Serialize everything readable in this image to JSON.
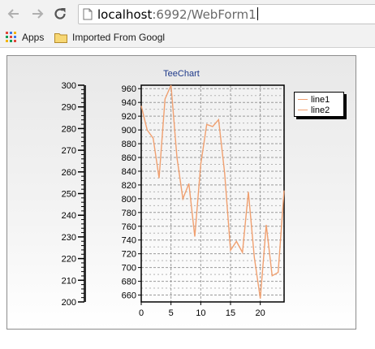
{
  "browser": {
    "url_host": "localhost",
    "url_rest": ":6992/WebForm1",
    "bookmarks": [
      {
        "label": "Apps",
        "icon": "apps-grid-icon"
      },
      {
        "label": "Imported From Googl",
        "icon": "folder-icon"
      }
    ]
  },
  "chart_data": {
    "type": "line",
    "title": "TeeChart",
    "left_axis": {
      "ticks": [
        "300",
        "290",
        "280",
        "270",
        "260",
        "250",
        "240",
        "230",
        "220",
        "210",
        "200"
      ],
      "ylim": [
        200,
        300
      ]
    },
    "ylim": [
      650,
      965
    ],
    "yticks": [
      "960",
      "940",
      "920",
      "900",
      "880",
      "860",
      "840",
      "820",
      "800",
      "780",
      "760",
      "740",
      "720",
      "700",
      "680",
      "660"
    ],
    "xlim": [
      0,
      24
    ],
    "xticks": [
      "0",
      "5",
      "10",
      "15",
      "20"
    ],
    "x": [
      0,
      1,
      2,
      3,
      4,
      5,
      6,
      7,
      8,
      9,
      10,
      11,
      12,
      13,
      14,
      15,
      16,
      17,
      18,
      19,
      20,
      21,
      22,
      23,
      24
    ],
    "series": [
      {
        "name": "line1",
        "color": "#f0a070",
        "values": [
          935,
          900,
          888,
          830,
          945,
          965,
          860,
          800,
          822,
          745,
          850,
          908,
          905,
          915,
          838,
          725,
          738,
          722,
          810,
          715,
          655,
          762,
          688,
          693,
          812
        ]
      },
      {
        "name": "line2",
        "color": "#f0a070",
        "values": []
      }
    ],
    "legend_position": "top-right",
    "grid": true
  }
}
